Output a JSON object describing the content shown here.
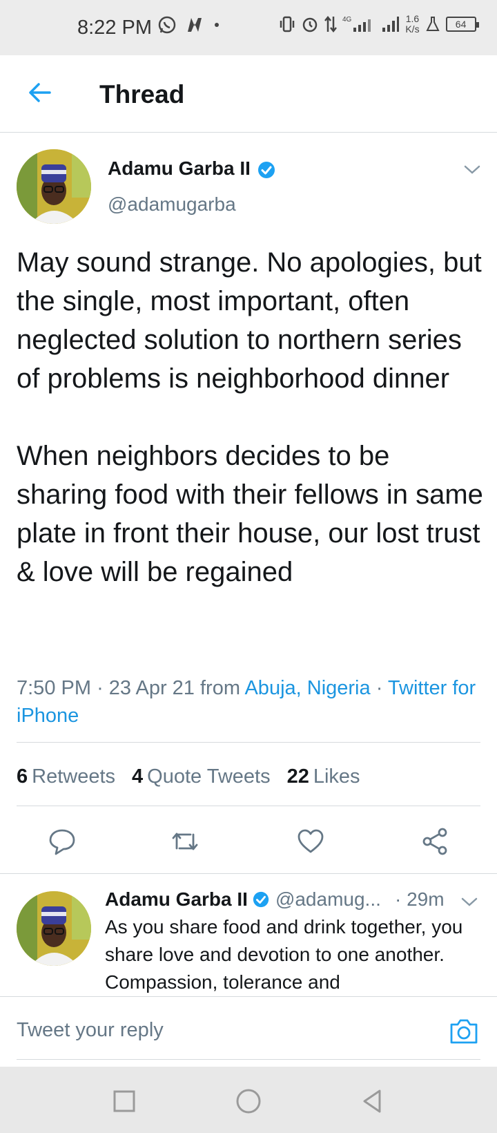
{
  "status_bar": {
    "time": "8:22 PM",
    "network": "4G",
    "speed_value": "1.6",
    "speed_unit": "K/s",
    "battery": "64"
  },
  "header": {
    "title": "Thread"
  },
  "main_tweet": {
    "author_name": "Adamu Garba II",
    "author_handle": "@adamugarba",
    "text": "May sound strange. No apologies, but the single, most important, often neglected solution to northern series of problems is neighborhood dinner\n\nWhen neighbors decides to be sharing food with their fellows in same plate in front their house, our lost trust & love will be regained",
    "time": "7:50 PM",
    "date": "23 Apr 21",
    "from_label": "from",
    "location": "Abuja, Nigeria",
    "source": "Twitter for iPhone",
    "stats": {
      "retweets_count": "6",
      "retweets_label": "Retweets",
      "quotes_count": "4",
      "quotes_label": "Quote Tweets",
      "likes_count": "22",
      "likes_label": "Likes"
    }
  },
  "reply_tweet": {
    "author_name": "Adamu Garba II",
    "author_handle": "@adamug...",
    "time": "· 29m",
    "text": "As you share food and drink together, you share love and devotion to one another. Compassion, tolerance and"
  },
  "composer": {
    "placeholder": "Tweet your reply"
  },
  "colors": {
    "accent": "#1da1f2",
    "link": "#1b95e0",
    "secondary_text": "#657786",
    "primary_text": "#14171a"
  }
}
